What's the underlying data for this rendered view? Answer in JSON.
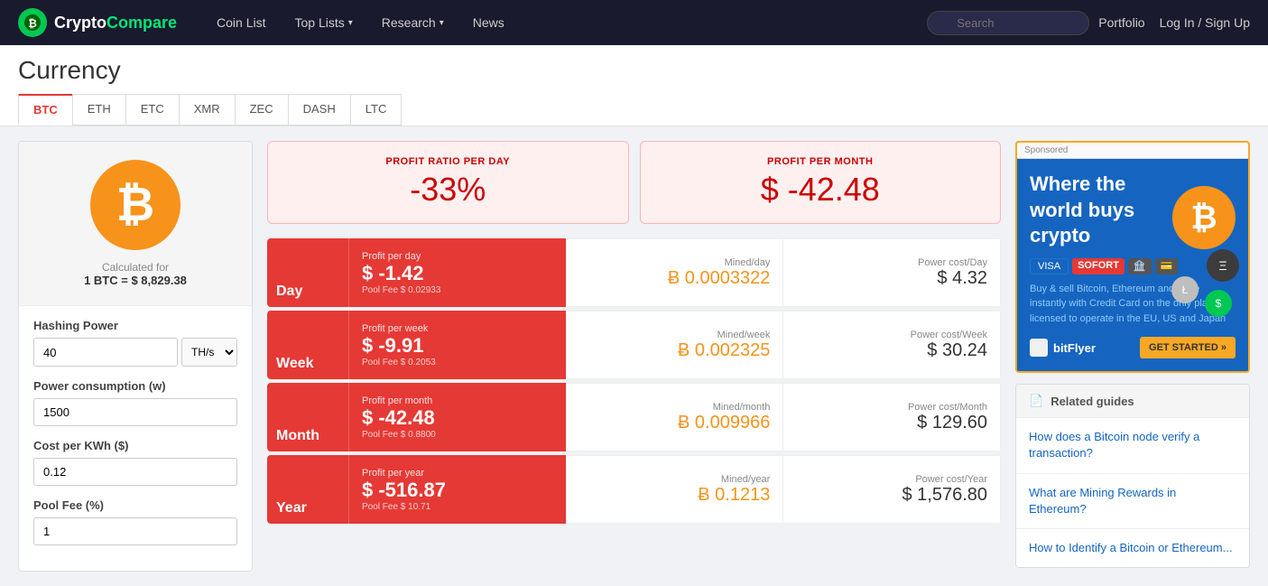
{
  "navbar": {
    "brand": "CryptoCompare",
    "brand_green": "Compare",
    "brand_white": "Crypto",
    "links": [
      {
        "label": "Coin List",
        "id": "coin-list",
        "hasChevron": false
      },
      {
        "label": "Top Lists",
        "id": "top-lists",
        "hasChevron": true
      },
      {
        "label": "Research",
        "id": "research",
        "hasChevron": true
      },
      {
        "label": "News",
        "id": "news",
        "hasChevron": false
      }
    ],
    "search_placeholder": "Search",
    "portfolio": "Portfolio",
    "login": "Log In / Sign Up"
  },
  "page": {
    "title": "Currency",
    "tabs": [
      "BTC",
      "ETH",
      "ETC",
      "XMR",
      "ZEC",
      "DASH",
      "LTC"
    ],
    "active_tab": "BTC"
  },
  "coin": {
    "symbol": "₿",
    "calc_for_label": "Calculated for",
    "calc_val": "1 BTC = $ 8,829.38"
  },
  "form": {
    "hashing_power_label": "Hashing Power",
    "hashing_power_value": "40",
    "hashing_unit": "TH/s",
    "power_consumption_label": "Power consumption (w)",
    "power_consumption_value": "1500",
    "cost_per_kwh_label": "Cost per KWh ($)",
    "cost_per_kwh_value": "0.12",
    "pool_fee_label": "Pool Fee (%)",
    "pool_fee_value": "1"
  },
  "profit_summary": {
    "ratio_label": "PROFIT RATIO PER DAY",
    "ratio_value": "-33%",
    "month_label": "PROFIT PER MONTH",
    "month_value": "$ -42.48"
  },
  "rows": [
    {
      "period": "Day",
      "profit_label": "Profit per day",
      "profit_value": "$ -1.42",
      "pool_fee": "Pool Fee $ 0.02933",
      "mined_label": "Mined/day",
      "mined_value": "Ƀ 0.0003322",
      "power_label": "Power cost/Day",
      "power_value": "$ 4.32"
    },
    {
      "period": "Week",
      "profit_label": "Profit per week",
      "profit_value": "$ -9.91",
      "pool_fee": "Pool Fee $ 0.2053",
      "mined_label": "Mined/week",
      "mined_value": "Ƀ 0.002325",
      "power_label": "Power cost/Week",
      "power_value": "$ 30.24"
    },
    {
      "period": "Month",
      "profit_label": "Profit per month",
      "profit_value": "$ -42.48",
      "pool_fee": "Pool Fee $ 0.8800",
      "mined_label": "Mined/month",
      "mined_value": "Ƀ 0.009966",
      "power_label": "Power cost/Month",
      "power_value": "$ 129.60"
    },
    {
      "period": "Year",
      "profit_label": "Profit per year",
      "profit_value": "$ -516.87",
      "pool_fee": "Pool Fee $ 10.71",
      "mined_label": "Mined/year",
      "mined_value": "Ƀ 0.1213",
      "power_label": "Power cost/Year",
      "power_value": "$ 1,576.80"
    }
  ],
  "ad": {
    "sponsored": "Sponsored",
    "title": "Where the world buys crypto",
    "payments": [
      "VISA",
      "SOFORT",
      "🏦",
      "💳"
    ],
    "body": "Buy & sell Bitcoin, Ethereum and more instantly with Credit Card on the only platform licensed to operate in the EU, US and Japan",
    "brand": "bitFlyer",
    "cta": "GET STARTED »"
  },
  "related": {
    "header": "Related guides",
    "items": [
      "How does a Bitcoin node verify a transaction?",
      "What are Mining Rewards in Ethereum?",
      "How to Identify a Bitcoin or Ethereum..."
    ]
  }
}
